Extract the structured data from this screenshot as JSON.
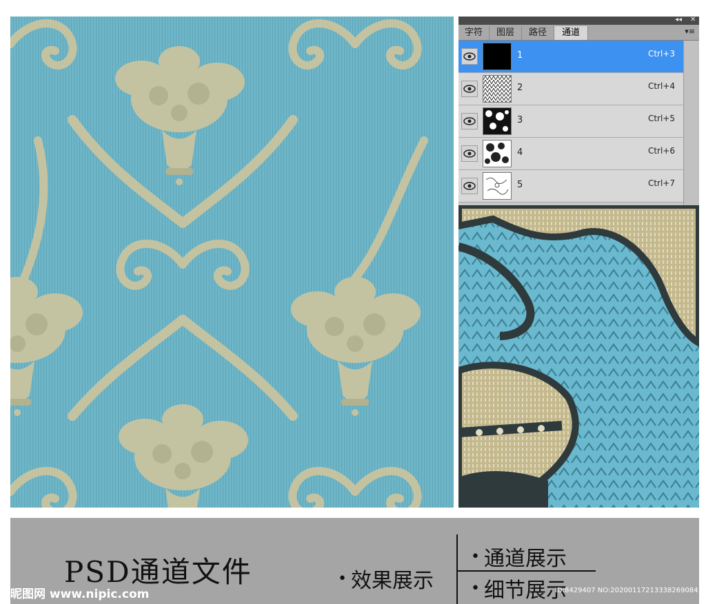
{
  "panel": {
    "tabs": [
      {
        "label": "字符"
      },
      {
        "label": "图层"
      },
      {
        "label": "路径"
      },
      {
        "label": "通道"
      }
    ],
    "window_controls": {
      "collapse": "◂◂",
      "close": "✕"
    },
    "channels": [
      {
        "name": "1",
        "shortcut": "Ctrl+3",
        "selected": true
      },
      {
        "name": "2",
        "shortcut": "Ctrl+4",
        "selected": false
      },
      {
        "name": "3",
        "shortcut": "Ctrl+5",
        "selected": false
      },
      {
        "name": "4",
        "shortcut": "Ctrl+6",
        "selected": false
      },
      {
        "name": "5",
        "shortcut": "Ctrl+7",
        "selected": false
      }
    ],
    "selection_color": "#3d91f0"
  },
  "caption": {
    "title": "PSD通道文件",
    "effect_label": "效果展示",
    "channel_label": "通道展示",
    "detail_label": "细节展示",
    "bullet": "•"
  },
  "watermark": {
    "site": "昵图网 www.nipic.com",
    "id_text": "ID:8429407 NO:20200117213338269084"
  },
  "colors": {
    "background_blue": "#6fb6c8",
    "ornament_beige": "#c9c5a0",
    "outline_dark": "#2f3a3c",
    "caption_gray": "#a5a5a5"
  }
}
